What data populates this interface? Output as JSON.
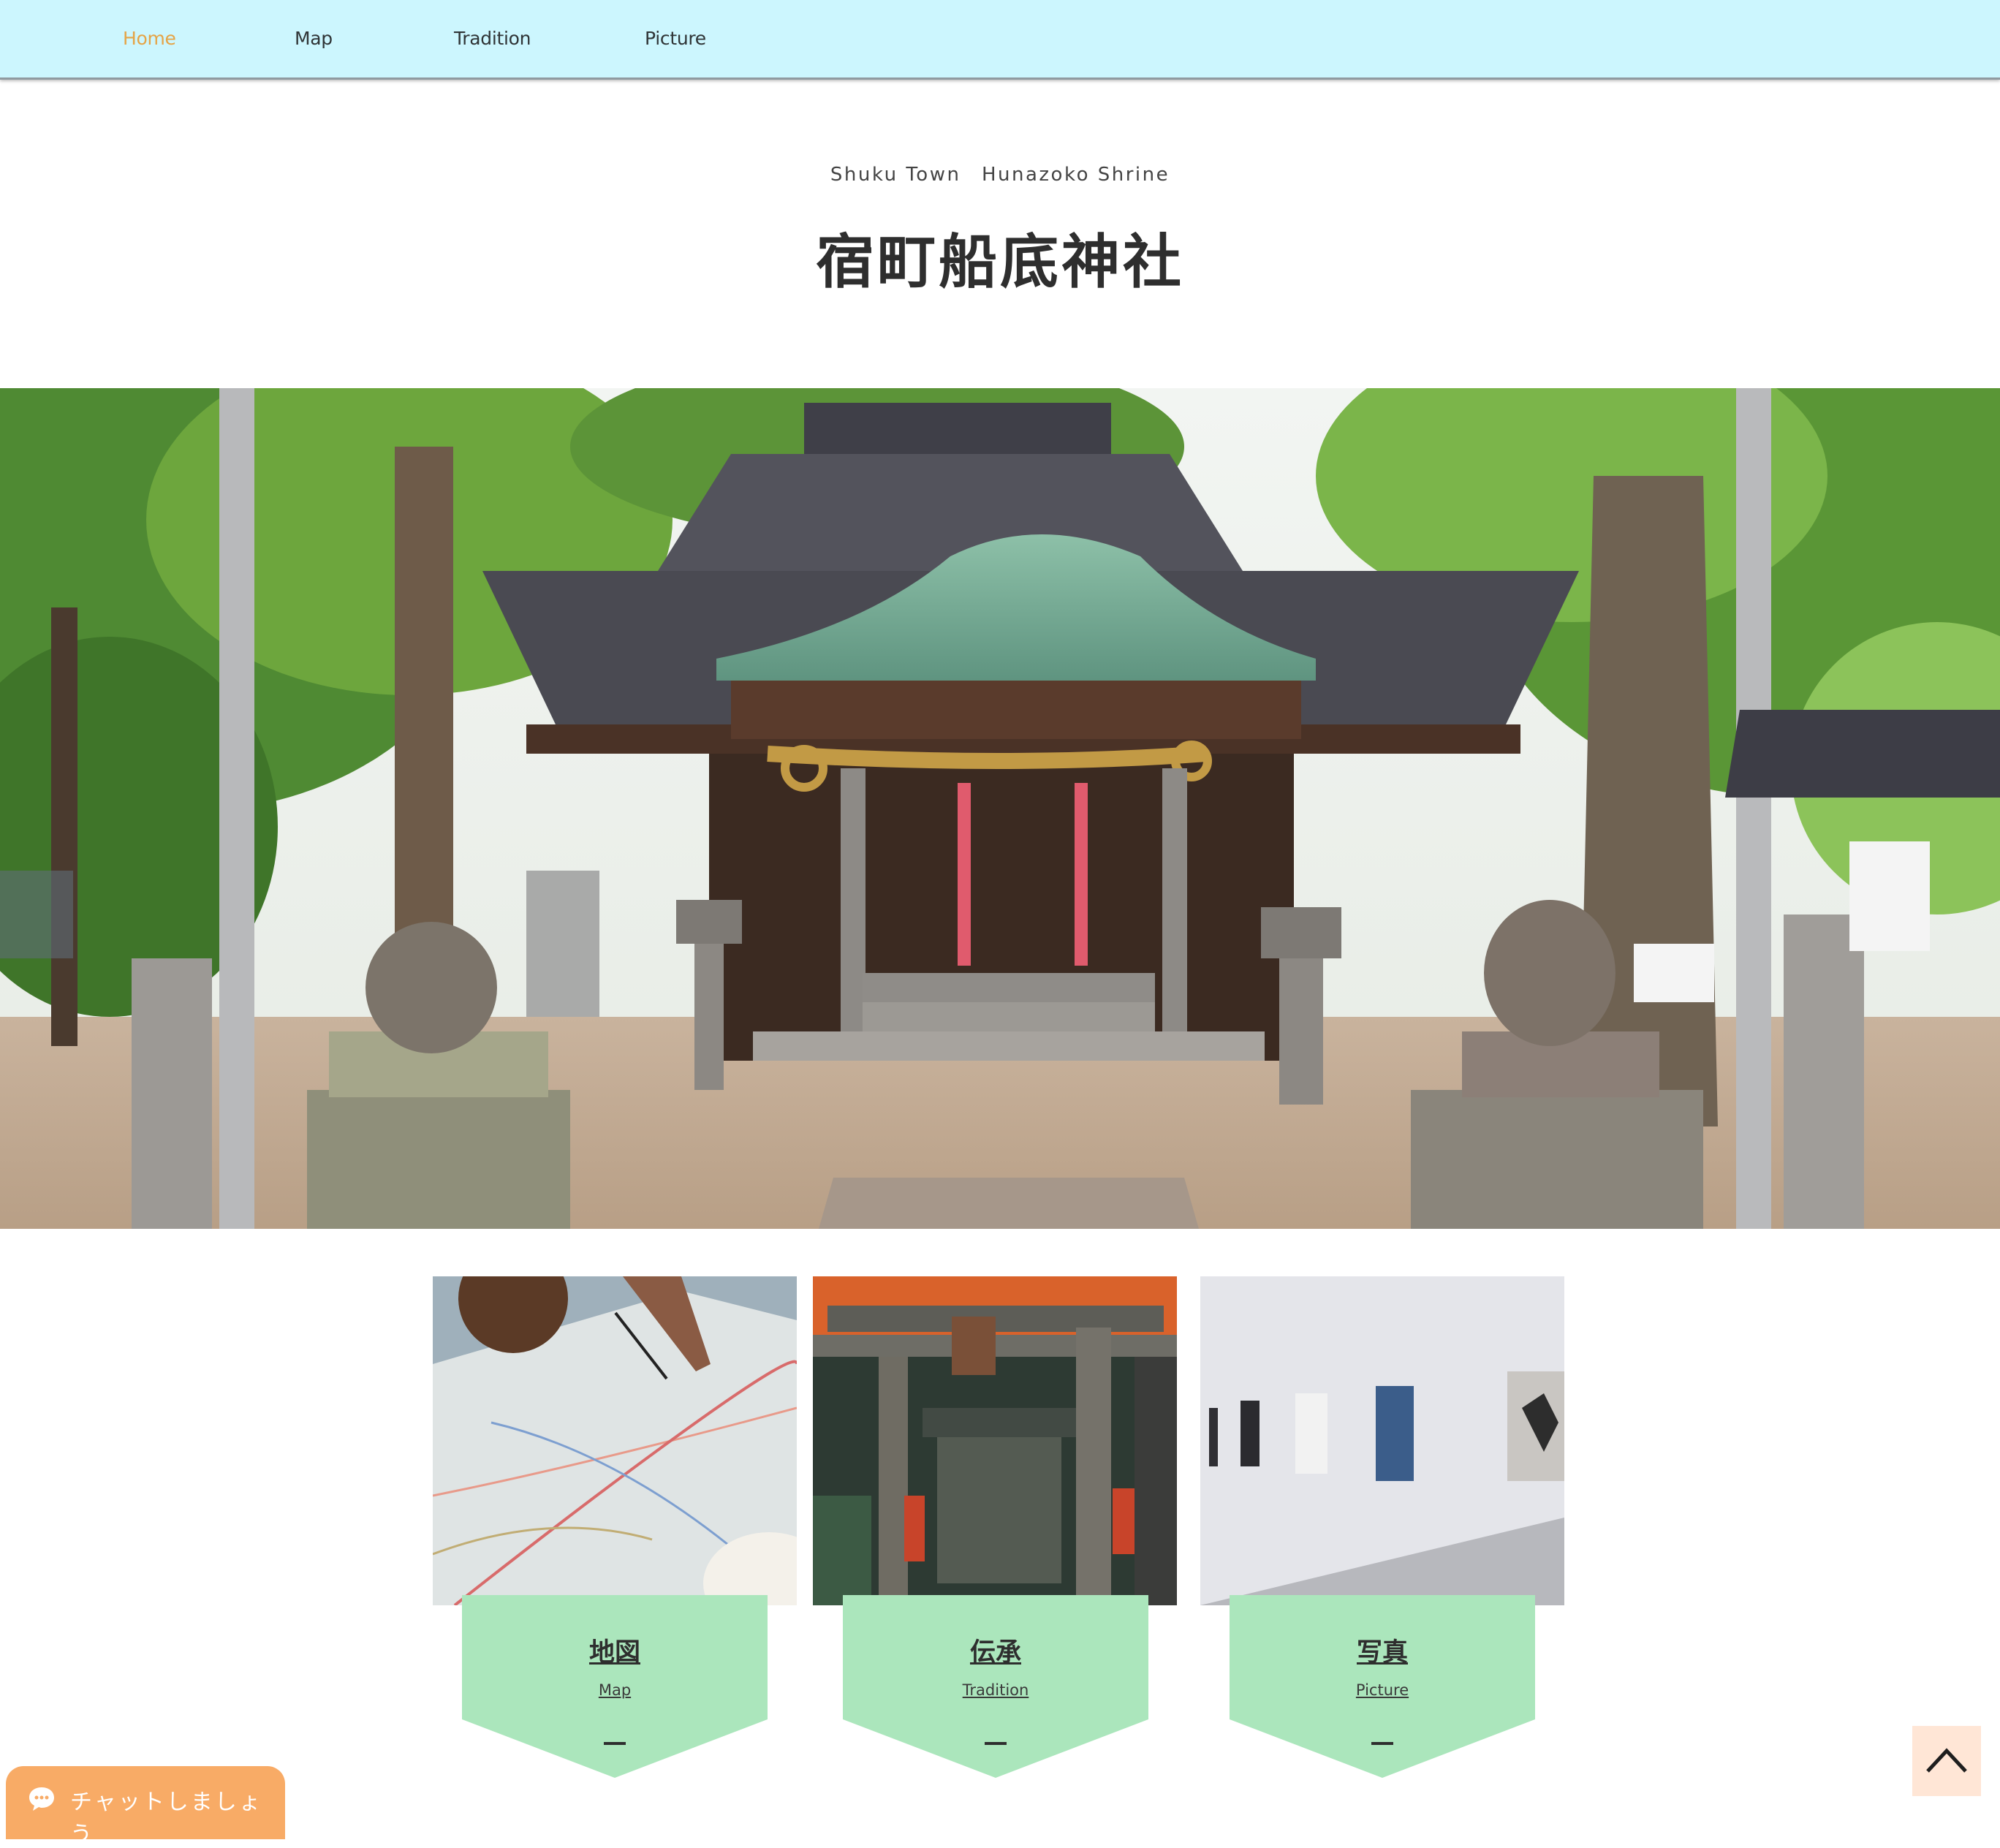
{
  "nav": {
    "items": [
      {
        "label": "Home",
        "active": true
      },
      {
        "label": "Map",
        "active": false
      },
      {
        "label": "Tradition",
        "active": false
      },
      {
        "label": "Picture",
        "active": false
      }
    ],
    "background": "#ccf6fe",
    "active_color": "#e5a447"
  },
  "header": {
    "subtitle": "Shuku Town　Hunazoko Shrine",
    "title": "宿町船底神社"
  },
  "hero": {
    "image": "shrine-photo"
  },
  "cards": [
    {
      "title": "地図",
      "subtitle": "Map",
      "image": "map-photo"
    },
    {
      "title": "伝承",
      "subtitle": "Tradition",
      "image": "torii-gate-photo"
    },
    {
      "title": "写真",
      "subtitle": "Picture",
      "image": "gallery-photo"
    }
  ],
  "badge_color": "#abe6bc",
  "chat": {
    "label": "チャットしましょう",
    "color": "#f8ab66"
  },
  "back_to_top": {
    "icon": "chevron-up-icon"
  }
}
